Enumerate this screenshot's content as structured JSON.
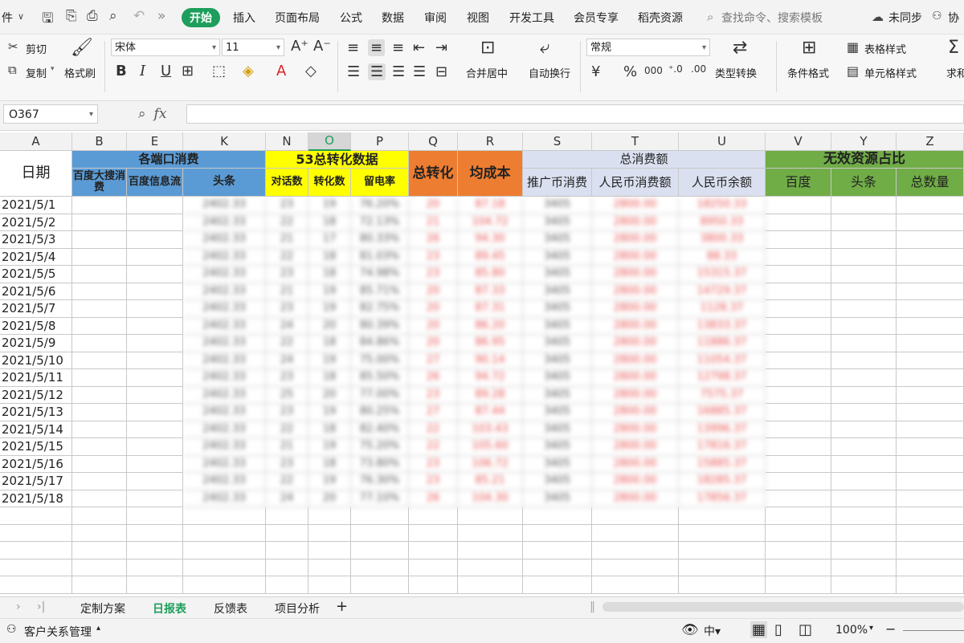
{
  "menubar": {
    "file_partial": "件",
    "tabs": [
      "开始",
      "插入",
      "页面布局",
      "公式",
      "数据",
      "审阅",
      "视图",
      "开发工具",
      "会员专享",
      "稻壳资源"
    ],
    "search_placeholder": "查找命令、搜索模板",
    "sync_label": "未同步",
    "collab_label": "协"
  },
  "ribbon": {
    "cut": "剪切",
    "copy": "复制",
    "format_painter": "格式刷",
    "font_name": "宋体",
    "font_size": "11",
    "merge_center": "合并居中",
    "wrap_text": "自动换行",
    "number_format": "常规",
    "type_convert": "类型转换",
    "conditional_format": "条件格式",
    "table_style": "表格样式",
    "cell_style": "单元格样式",
    "sum_partial": "求和",
    "percent": "%",
    "thousands": "000",
    "yuan": "¥"
  },
  "formula": {
    "cell_ref": "O367",
    "fx": "fx",
    "value": ""
  },
  "columns": [
    "A",
    "B",
    "E",
    "K",
    "N",
    "O",
    "P",
    "Q",
    "R",
    "S",
    "T",
    "U",
    "V",
    "Y",
    "Z"
  ],
  "active_column": "O",
  "headers": {
    "date": "日期",
    "group_spend": "各端口消费",
    "baidu_search": "百度大搜消费",
    "baidu_feed": "百度信息流",
    "toutiao": "头条",
    "group_53": "53总转化数据",
    "dialogs": "对话数",
    "conversions": "转化数",
    "retention": "留电率",
    "total_conv": "总转化",
    "avg_cost": "均成本",
    "group_total_spend": "总消费额",
    "promo_coin": "推广币消费",
    "rmb_spend": "人民币消费额",
    "rmb_balance": "人民币余额",
    "group_invalid": "无效资源占比",
    "inv_baidu": "百度",
    "inv_toutiao": "头条",
    "inv_total": "总数量"
  },
  "rows": [
    {
      "date": "2021/5/1",
      "k": "2402.33",
      "n": "23",
      "o": "19",
      "p": "76.20%",
      "q": "20",
      "r": "87.18",
      "s": "3405",
      "t": "2800.00",
      "u": "18250.33"
    },
    {
      "date": "2021/5/2",
      "k": "2402.33",
      "n": "22",
      "o": "18",
      "p": "72.13%",
      "q": "21",
      "r": "104.72",
      "s": "3405",
      "t": "2800.00",
      "u": "8950.33"
    },
    {
      "date": "2021/5/3",
      "k": "2402.33",
      "n": "21",
      "o": "17",
      "p": "80.33%",
      "q": "26",
      "r": "94.30",
      "s": "3405",
      "t": "2800.00",
      "u": "3800.33"
    },
    {
      "date": "2021/5/4",
      "k": "2402.33",
      "n": "22",
      "o": "18",
      "p": "81.03%",
      "q": "23",
      "r": "89.45",
      "s": "3405",
      "t": "2800.00",
      "u": "88.33"
    },
    {
      "date": "2021/5/5",
      "k": "2402.33",
      "n": "23",
      "o": "18",
      "p": "74.98%",
      "q": "23",
      "r": "85.80",
      "s": "3405",
      "t": "2800.00",
      "u": "15315.37"
    },
    {
      "date": "2021/5/6",
      "k": "2402.33",
      "n": "21",
      "o": "19",
      "p": "85.71%",
      "q": "20",
      "r": "87.33",
      "s": "3405",
      "t": "2800.00",
      "u": "14729.37"
    },
    {
      "date": "2021/5/7",
      "k": "2402.33",
      "n": "23",
      "o": "19",
      "p": "82.75%",
      "q": "20",
      "r": "87.31",
      "s": "3405",
      "t": "2800.00",
      "u": "1128.37"
    },
    {
      "date": "2021/5/8",
      "k": "2402.33",
      "n": "24",
      "o": "20",
      "p": "80.39%",
      "q": "20",
      "r": "86.20",
      "s": "3405",
      "t": "2800.00",
      "u": "13833.37"
    },
    {
      "date": "2021/5/9",
      "k": "2402.33",
      "n": "22",
      "o": "18",
      "p": "84.86%",
      "q": "20",
      "r": "86.95",
      "s": "3405",
      "t": "2800.00",
      "u": "11886.37"
    },
    {
      "date": "2021/5/10",
      "k": "2402.33",
      "n": "24",
      "o": "19",
      "p": "75.00%",
      "q": "27",
      "r": "90.14",
      "s": "3405",
      "t": "2800.00",
      "u": "11054.37"
    },
    {
      "date": "2021/5/11",
      "k": "2402.33",
      "n": "23",
      "o": "18",
      "p": "85.50%",
      "q": "26",
      "r": "94.72",
      "s": "3405",
      "t": "2800.00",
      "u": "12798.37"
    },
    {
      "date": "2021/5/12",
      "k": "2402.33",
      "n": "25",
      "o": "20",
      "p": "77.00%",
      "q": "23",
      "r": "89.28",
      "s": "3405",
      "t": "2800.00",
      "u": "7575.37"
    },
    {
      "date": "2021/5/13",
      "k": "2402.33",
      "n": "23",
      "o": "19",
      "p": "80.25%",
      "q": "27",
      "r": "87.44",
      "s": "3405",
      "t": "2800.00",
      "u": "16885.37"
    },
    {
      "date": "2021/5/14",
      "k": "2402.33",
      "n": "22",
      "o": "18",
      "p": "82.40%",
      "q": "22",
      "r": "103.43",
      "s": "3405",
      "t": "2800.00",
      "u": "13996.37"
    },
    {
      "date": "2021/5/15",
      "k": "2402.33",
      "n": "21",
      "o": "19",
      "p": "75.20%",
      "q": "22",
      "r": "105.60",
      "s": "3405",
      "t": "2800.00",
      "u": "17816.37"
    },
    {
      "date": "2021/5/16",
      "k": "2402.33",
      "n": "23",
      "o": "18",
      "p": "73.80%",
      "q": "23",
      "r": "106.72",
      "s": "3405",
      "t": "2800.00",
      "u": "15885.37"
    },
    {
      "date": "2021/5/17",
      "k": "2402.33",
      "n": "22",
      "o": "19",
      "p": "76.30%",
      "q": "23",
      "r": "85.21",
      "s": "3405",
      "t": "2800.00",
      "u": "18285.37"
    },
    {
      "date": "2021/5/18",
      "k": "2402.33",
      "n": "24",
      "o": "20",
      "p": "77.10%",
      "q": "26",
      "r": "104.30",
      "s": "3405",
      "t": "2800.00",
      "u": "17856.37"
    }
  ],
  "colors": {
    "blue_header": "#5b9bd5",
    "yellow_header": "#ffff00",
    "orange_header": "#ed7d31",
    "lavender_header": "#dae0f0",
    "green_header": "#70ad47",
    "accent": "#1e9e5c"
  },
  "sheets": {
    "tabs": [
      "定制方案",
      "日报表",
      "反馈表",
      "项目分析"
    ],
    "active": "日报表",
    "add": "+"
  },
  "status": {
    "left_label": "客户关系管理",
    "zoom": "100%",
    "zoom_minus": "−"
  }
}
